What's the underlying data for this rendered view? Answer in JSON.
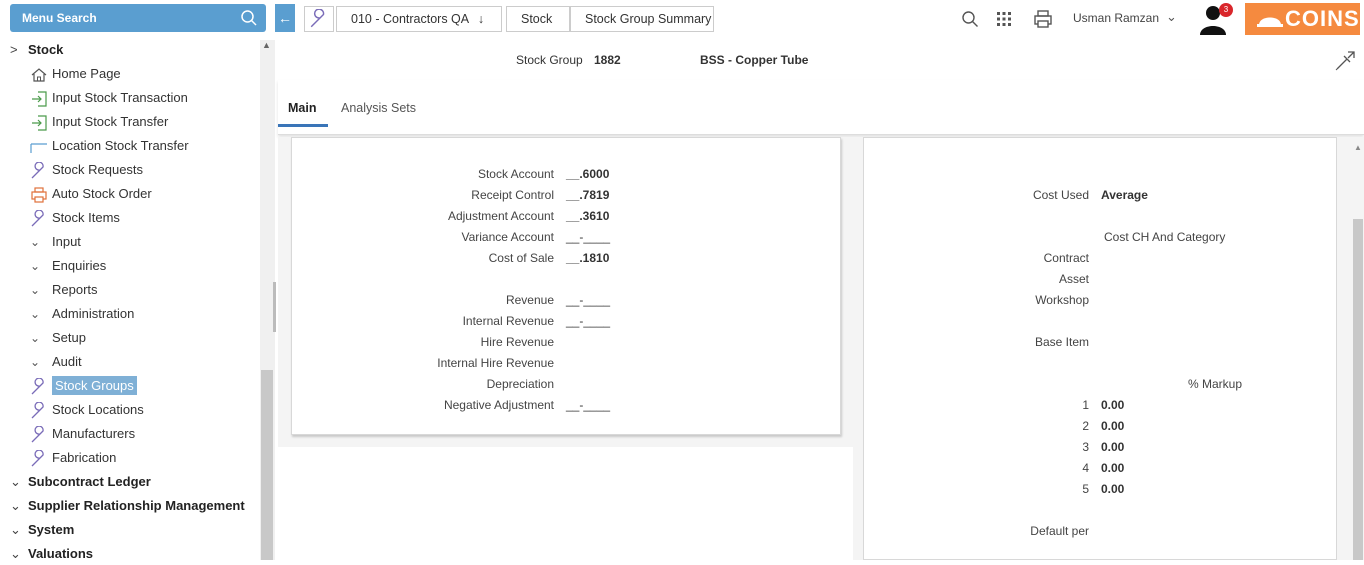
{
  "sidebar": {
    "search_label": "Menu Search",
    "items": [
      {
        "label": "Stock"
      },
      {
        "label": "Home Page"
      },
      {
        "label": "Input Stock Transaction"
      },
      {
        "label": "Input Stock Transfer"
      },
      {
        "label": "Location Stock Transfer"
      },
      {
        "label": "Stock Requests"
      },
      {
        "label": "Auto Stock Order"
      },
      {
        "label": "Stock Items"
      },
      {
        "label": "Input"
      },
      {
        "label": "Enquiries"
      },
      {
        "label": "Reports"
      },
      {
        "label": "Administration"
      },
      {
        "label": "Setup"
      },
      {
        "label": "Audit"
      },
      {
        "label": "Stock Groups"
      },
      {
        "label": "Stock Locations"
      },
      {
        "label": "Manufacturers"
      },
      {
        "label": "Fabrication"
      },
      {
        "label": "Subcontract Ledger"
      },
      {
        "label": "Supplier Relationship Management"
      },
      {
        "label": "System"
      },
      {
        "label": "Valuations"
      }
    ]
  },
  "breadcrumb": {
    "company": "010 - Contractors QA",
    "module": "Stock",
    "page": "Stock Group Summary"
  },
  "user": {
    "name": "Usman Ramzan",
    "notifications": "3"
  },
  "logo_text": "COINS",
  "header": {
    "group_label": "Stock Group",
    "group_code": "1882",
    "group_name": "BSS - Copper Tube"
  },
  "tabs": [
    {
      "label": "Main"
    },
    {
      "label": "Analysis Sets"
    }
  ],
  "accounts": [
    {
      "label": "Stock Account",
      "value": "__.6000"
    },
    {
      "label": "Receipt Control",
      "value": "__.7819"
    },
    {
      "label": "Adjustment Account",
      "value": "__.3610"
    },
    {
      "label": "Variance Account",
      "value": "__-____"
    },
    {
      "label": "Cost of Sale",
      "value": "__.1810"
    },
    {
      "label": "Revenue",
      "value": "__-____"
    },
    {
      "label": "Internal Revenue",
      "value": "__-____"
    },
    {
      "label": "Hire Revenue",
      "value": ""
    },
    {
      "label": "Internal Hire Revenue",
      "value": ""
    },
    {
      "label": "Depreciation",
      "value": ""
    },
    {
      "label": "Negative Adjustment",
      "value": "__-____"
    }
  ],
  "costing": {
    "cost_used_label": "Cost Used",
    "cost_used_value": "Average",
    "cost_ch_heading": "Cost CH And Category",
    "contract_label": "Contract",
    "asset_label": "Asset",
    "workshop_label": "Workshop",
    "base_item_label": "Base Item",
    "markup_heading": "% Markup",
    "markups": [
      {
        "n": "1",
        "value": "0.00"
      },
      {
        "n": "2",
        "value": "0.00"
      },
      {
        "n": "3",
        "value": "0.00"
      },
      {
        "n": "4",
        "value": "0.00"
      },
      {
        "n": "5",
        "value": "0.00"
      }
    ],
    "default_per_label": "Default per"
  },
  "colors": {
    "accent": "#5a9ed0",
    "selected": "#7fb0d6",
    "logo": "#f58a3f",
    "tab_underline": "#3a75b8",
    "badge": "#d9262b"
  }
}
